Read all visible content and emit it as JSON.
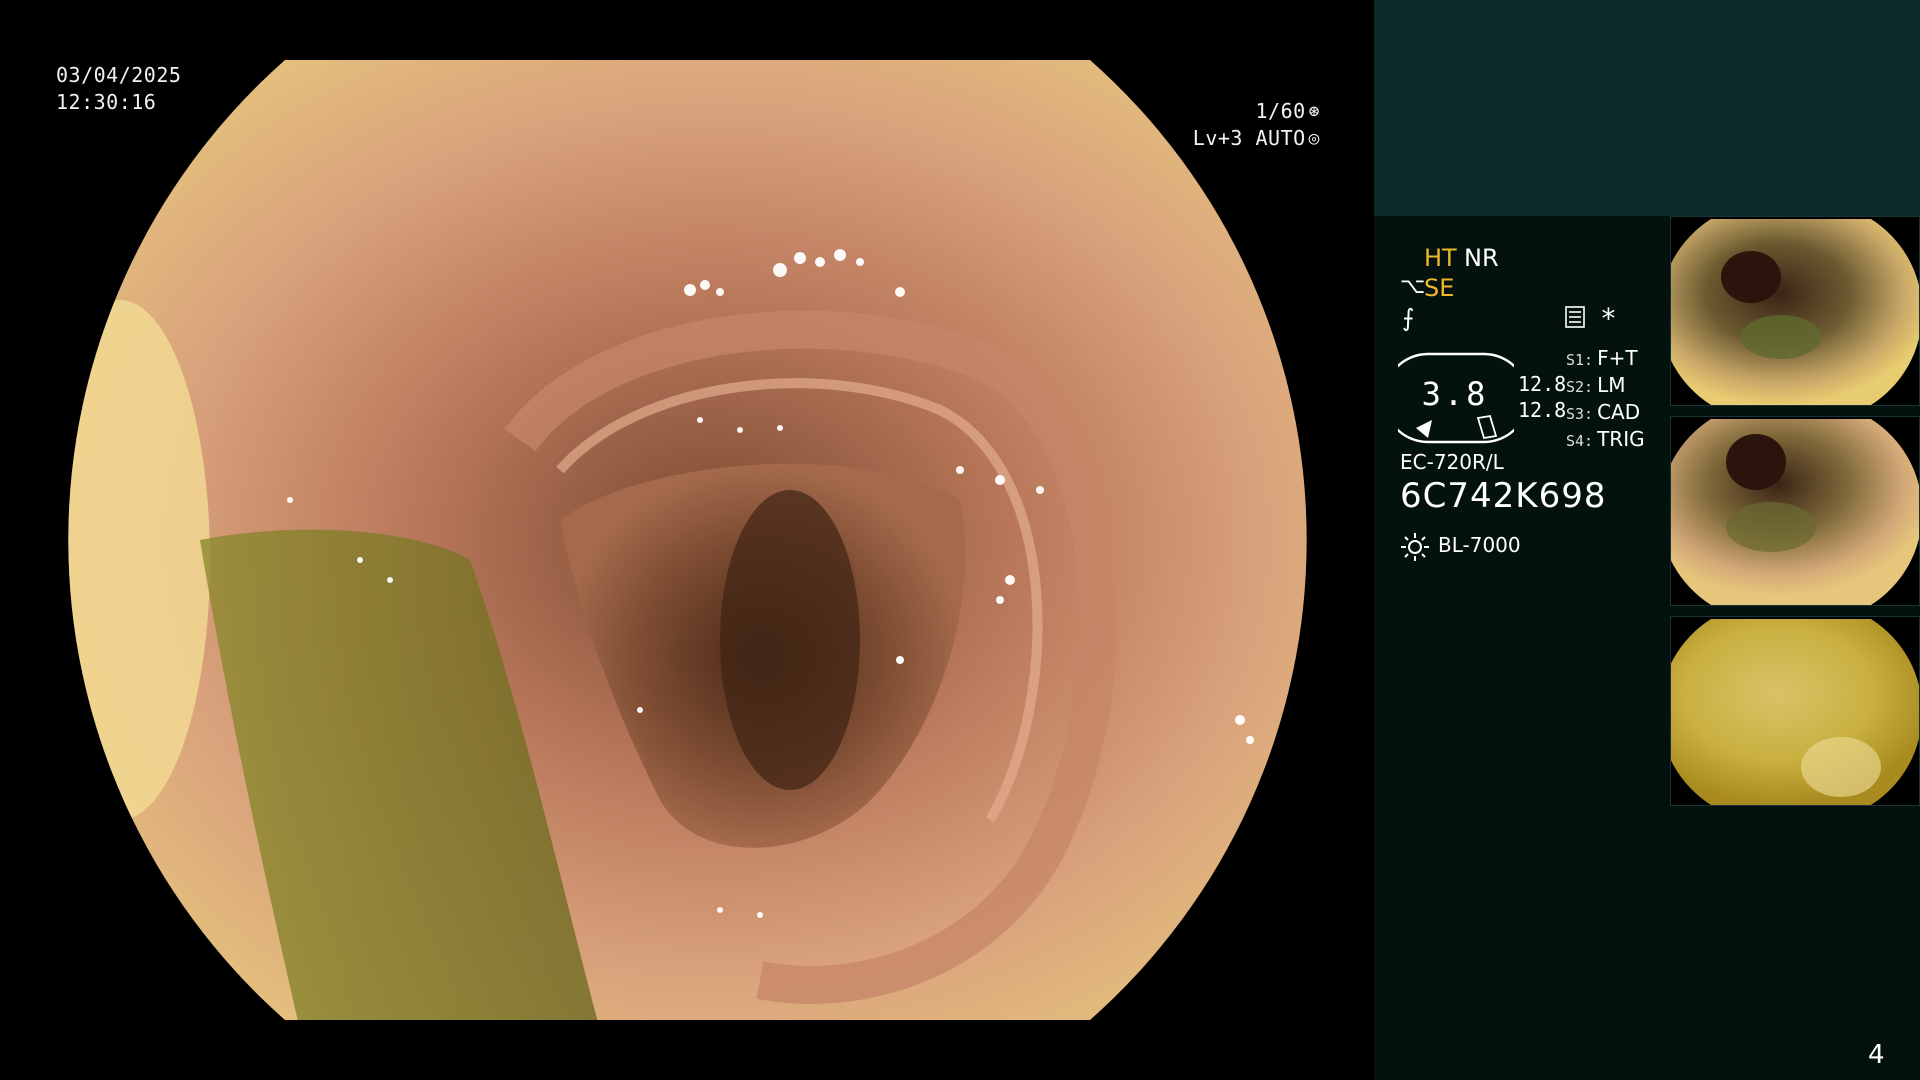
{
  "osd": {
    "date": "03/04/2025",
    "time": "12:30:16",
    "shutter": "1/60",
    "exposure": "Lv+3 AUTO"
  },
  "panel": {
    "mode_ht": "HT",
    "mode_nr": "NR",
    "mode_se": "SE",
    "asterisk": "*",
    "gauge_value": "3.8",
    "gauge_sub_1": "12.8",
    "gauge_sub_2": "12.8",
    "switches": [
      {
        "key": "S1:",
        "value": "F+T"
      },
      {
        "key": "S2:",
        "value": "LM"
      },
      {
        "key": "S3:",
        "value": "CAD"
      },
      {
        "key": "S4:",
        "value": "TRIG"
      }
    ],
    "scope_model": "EC-720R/L",
    "scope_serial": "6C742K698",
    "light_source": "BL-7000"
  },
  "page_number": "4",
  "colors": {
    "side_top": "#0c2a28",
    "side_main": "#04120f",
    "accent": "#f0b72a"
  },
  "icons": [
    "shutter-icon",
    "iris-icon",
    "structure-enhance-icon",
    "freeze-icon",
    "menu-icon",
    "light-source-icon"
  ]
}
